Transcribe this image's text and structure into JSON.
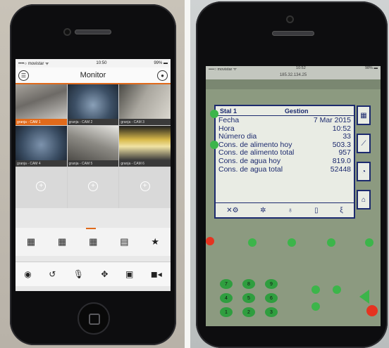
{
  "left_phone": {
    "status": {
      "carrier": "••••○ movistar ᯤ",
      "time": "10:50",
      "battery": "99% ▬"
    },
    "nav": {
      "title": "Monitor",
      "menu_icon": "menu-icon",
      "record_icon": "record-toggle-icon"
    },
    "cameras": [
      {
        "label": "granja - CAM 1",
        "active": true
      },
      {
        "label": "granja - CAM 2",
        "active": false
      },
      {
        "label": "granja - CAM 3",
        "active": false
      },
      {
        "label": "granja - CAM 4",
        "active": false
      },
      {
        "label": "granja - CAM 5",
        "active": false
      },
      {
        "label": "granja - CAM 6",
        "active": false
      },
      {
        "label": "",
        "active": false
      },
      {
        "label": "",
        "active": false
      },
      {
        "label": "",
        "active": false
      }
    ],
    "layout_icons": [
      "grid-4-icon",
      "grid-9-icon",
      "grid-16-icon",
      "grid-custom-icon",
      "favorite-star-icon"
    ],
    "toolbar_icons": [
      "camera-snapshot-icon",
      "playback-history-icon",
      "microphone-icon",
      "ptz-move-icon",
      "cast-display-icon",
      "video-record-icon"
    ]
  },
  "right_phone": {
    "status": {
      "carrier": "••••○ movistar ᯤ",
      "time": "10:52",
      "battery": "98% ▬"
    },
    "address": "185.32.134.25",
    "panel": {
      "station": "Stal 1",
      "section": "Gestion",
      "rows": [
        {
          "label": "Fecha",
          "value": "7 Mar 2015"
        },
        {
          "label": "Hora",
          "value": "10:52"
        },
        {
          "label": "Número dia",
          "value": "33"
        },
        {
          "label": "Cons. de alimento hoy",
          "value": "503.3"
        },
        {
          "label": "Cons. de alimento total",
          "value": "957"
        },
        {
          "label": "Cons. de agua hoy",
          "value": "819.0"
        },
        {
          "label": "Cons. de agua total",
          "value": "52448"
        }
      ]
    },
    "keypad_keys": [
      "7",
      "8",
      "9",
      "4",
      "5",
      "6",
      "1",
      "2",
      "3"
    ]
  }
}
